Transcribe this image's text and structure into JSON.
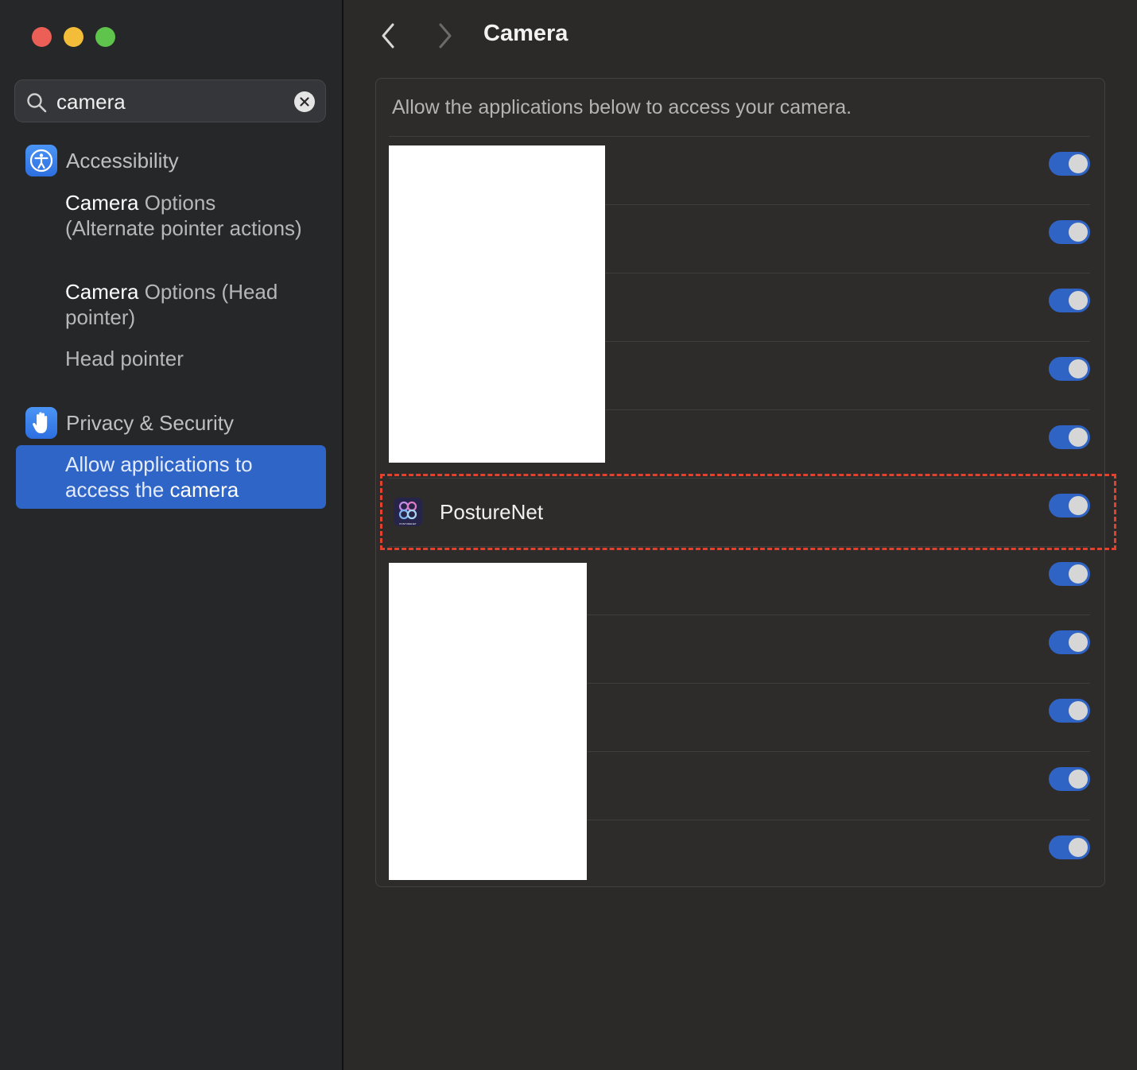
{
  "window": {
    "traffic_lights": [
      "close",
      "minimize",
      "zoom"
    ],
    "colors": {
      "close": "#ec5f57",
      "minimize": "#f3bd39",
      "zoom": "#5ec44b"
    }
  },
  "sidebar": {
    "search": {
      "value": "camera",
      "placeholder": "Search"
    },
    "groups": [
      {
        "label": "Accessibility",
        "icon": "accessibility-icon",
        "items": [
          {
            "match": "Camera",
            "rest": " Options (Alternate pointer actions)"
          },
          {
            "match": "Camera",
            "rest": " Options (Head pointer)"
          },
          {
            "match": "",
            "rest": "Head pointer"
          }
        ]
      },
      {
        "label": "Privacy & Security",
        "icon": "hand-icon",
        "items": [
          {
            "pre": "Allow applications to access the ",
            "match": "camera",
            "selected": true
          }
        ]
      }
    ],
    "accent": "#2f65c7"
  },
  "header": {
    "title": "Camera",
    "back_icon": "chevron-left-icon",
    "forward_icon": "chevron-right-icon"
  },
  "panel": {
    "description": "Allow the applications below to access your camera.",
    "apps": [
      {
        "name": "",
        "enabled": true,
        "redacted": true
      },
      {
        "name": "",
        "enabled": true,
        "redacted": true
      },
      {
        "name": "",
        "enabled": true,
        "redacted": true
      },
      {
        "name": "",
        "enabled": true,
        "redacted": true
      },
      {
        "name": "",
        "enabled": true,
        "redacted": true
      },
      {
        "name": "PostureNet",
        "enabled": true,
        "icon": "posturenet-icon",
        "icon_caption": "POSTURENET"
      },
      {
        "name": "",
        "enabled": true,
        "redacted": true
      },
      {
        "name": "",
        "enabled": true,
        "redacted": true
      },
      {
        "name": "",
        "enabled": true,
        "redacted": true
      },
      {
        "name": "",
        "enabled": true,
        "redacted": true
      },
      {
        "name": "",
        "enabled": true,
        "redacted": true
      }
    ],
    "toggle_color": "#2f63c4",
    "annotation_color": "#e2412e"
  }
}
